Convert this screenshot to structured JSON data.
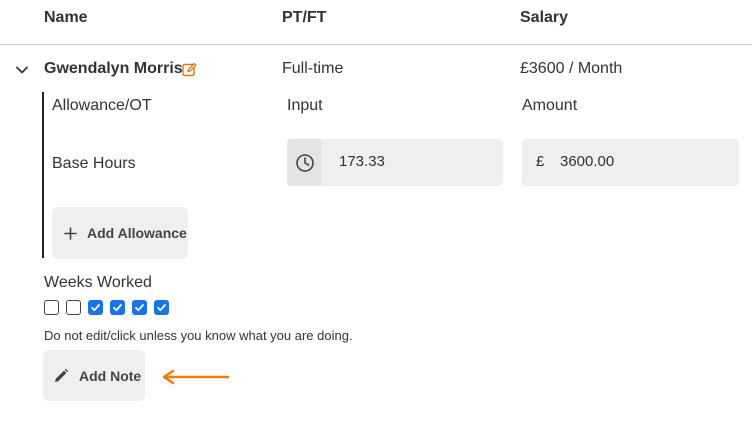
{
  "table": {
    "columns": [
      "Name",
      "PT/FT",
      "Salary"
    ]
  },
  "employee": {
    "name": "Gwendalyn Morris",
    "type": "Full-time",
    "salary": "£3600 / Month"
  },
  "allowance": {
    "headers": [
      "Allowance/OT",
      "Input",
      "Amount"
    ],
    "base_hours_label": "Base Hours",
    "base_hours_value": "173.33",
    "amount_currency": "£",
    "amount_value": "3600.00",
    "add_allowance_label": "Add Allowance"
  },
  "weeks": {
    "label": "Weeks Worked",
    "checked": [
      false,
      false,
      true,
      true,
      true,
      true
    ]
  },
  "warning": "Do not edit/click unless you know what you are doing.",
  "add_note_label": "Add Note",
  "colors": {
    "edit_icon": "#e8730c",
    "checkbox_checked": "#1a73e8",
    "arrow": "#f07d00"
  },
  "icons": [
    "chevron-down-icon",
    "edit-icon",
    "clock-icon",
    "plus-icon",
    "pencil-icon",
    "arrow-left-icon",
    "check-icon"
  ]
}
